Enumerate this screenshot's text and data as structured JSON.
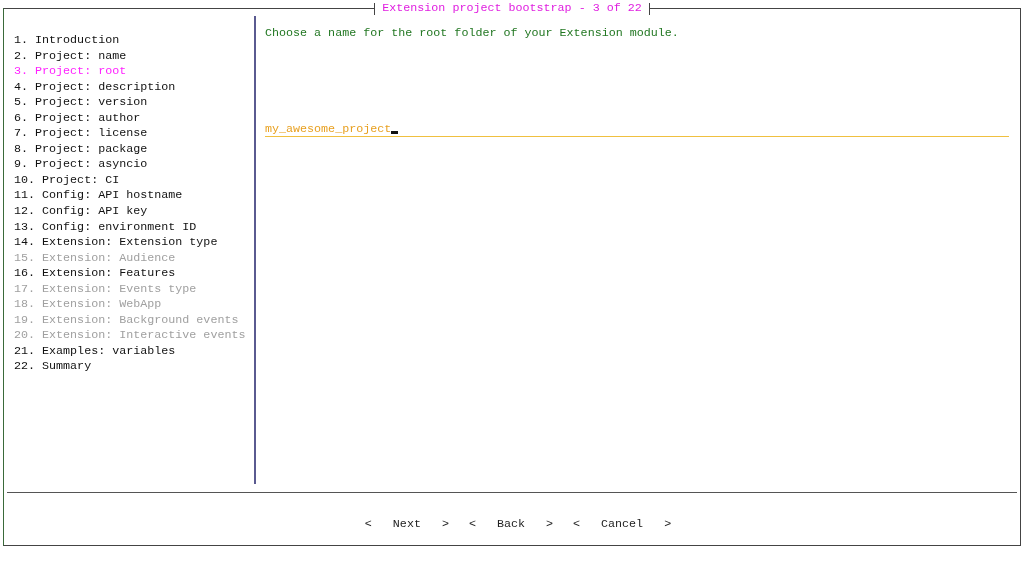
{
  "window": {
    "title": "Extension project bootstrap - 3 of 22"
  },
  "steps": [
    {
      "label": "1. Introduction",
      "selected": false,
      "disabled": false
    },
    {
      "label": "2. Project: name",
      "selected": false,
      "disabled": false
    },
    {
      "label": "3. Project: root",
      "selected": true,
      "disabled": false
    },
    {
      "label": "4. Project: description",
      "selected": false,
      "disabled": false
    },
    {
      "label": "5. Project: version",
      "selected": false,
      "disabled": false
    },
    {
      "label": "6. Project: author",
      "selected": false,
      "disabled": false
    },
    {
      "label": "7. Project: license",
      "selected": false,
      "disabled": false
    },
    {
      "label": "8. Project: package",
      "selected": false,
      "disabled": false
    },
    {
      "label": "9. Project: asyncio",
      "selected": false,
      "disabled": false
    },
    {
      "label": "10. Project: CI",
      "selected": false,
      "disabled": false
    },
    {
      "label": "11. Config: API hostname",
      "selected": false,
      "disabled": false
    },
    {
      "label": "12. Config: API key",
      "selected": false,
      "disabled": false
    },
    {
      "label": "13. Config: environment ID",
      "selected": false,
      "disabled": false
    },
    {
      "label": "14. Extension: Extension type",
      "selected": false,
      "disabled": false
    },
    {
      "label": "15. Extension: Audience",
      "selected": false,
      "disabled": true
    },
    {
      "label": "16. Extension: Features",
      "selected": false,
      "disabled": false
    },
    {
      "label": "17. Extension: Events type",
      "selected": false,
      "disabled": true
    },
    {
      "label": "18. Extension: WebApp",
      "selected": false,
      "disabled": true
    },
    {
      "label": "19. Extension: Background events",
      "selected": false,
      "disabled": true
    },
    {
      "label": "20. Extension: Interactive events",
      "selected": false,
      "disabled": true
    },
    {
      "label": "21. Examples: variables",
      "selected": false,
      "disabled": false
    },
    {
      "label": "22. Summary",
      "selected": false,
      "disabled": false
    }
  ],
  "prompt": "Choose a name for the root folder of your Extension module.",
  "input": {
    "value": "my_awesome_project"
  },
  "buttons": [
    {
      "open": "<",
      "label": "Next",
      "close": ">"
    },
    {
      "open": "<",
      "label": "Back",
      "close": ">"
    },
    {
      "open": "<",
      "label": "Cancel",
      "close": ">"
    }
  ]
}
